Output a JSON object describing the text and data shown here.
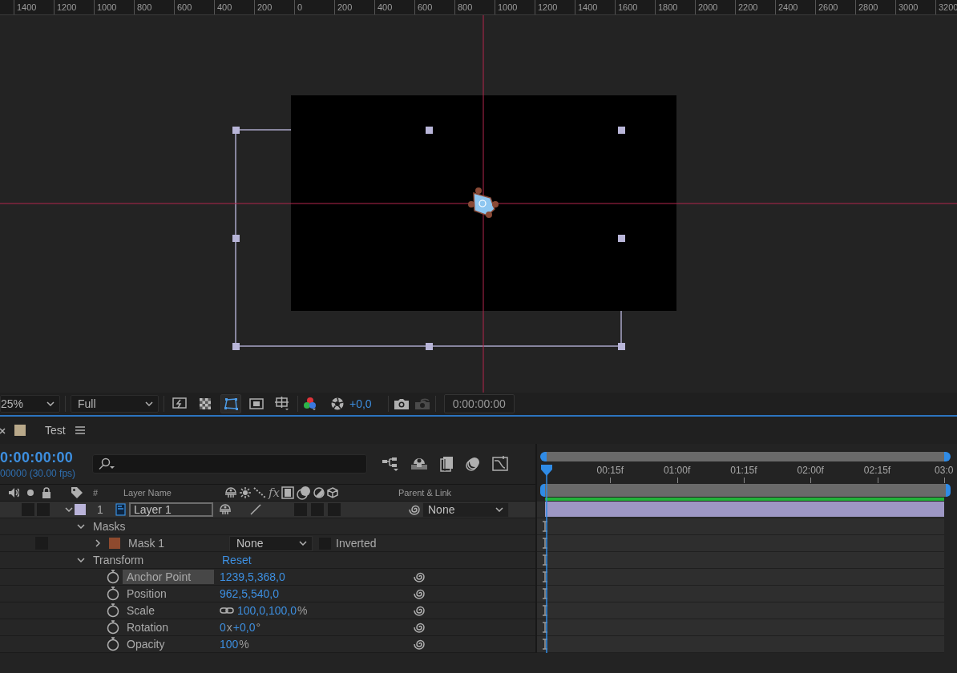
{
  "viewer": {
    "ruler_labels": [
      "1400",
      "1200",
      "1000",
      "800",
      "600",
      "400",
      "200",
      "0",
      "200",
      "400",
      "600",
      "800",
      "1000",
      "1200",
      "1400",
      "1600",
      "1800",
      "2000",
      "2200",
      "2400",
      "2600",
      "2800",
      "3000",
      "3200"
    ],
    "toolbar": {
      "zoom": "25%",
      "resolution": "Full",
      "view_buttons": [
        {
          "kind": "fast-previews",
          "selected": false
        },
        {
          "kind": "transparency-grid",
          "selected": false
        },
        {
          "kind": "mask-path",
          "selected": true
        },
        {
          "kind": "region",
          "selected": false
        },
        {
          "kind": "grid-guides",
          "selected": false
        }
      ],
      "exposure": "+0,0",
      "timecode": "0:00:00:00"
    }
  },
  "timeline": {
    "tab": {
      "title": "Test",
      "color": "#b9a98a"
    },
    "timecode": "0:00:00:00",
    "frame_info": "00000 (30.00 fps)",
    "columns": {
      "number": "#",
      "layer_name": "Layer Name",
      "fx": "fx",
      "parent": "Parent & Link"
    },
    "ruler_labels": [
      "00:15f",
      "01:00f",
      "01:15f",
      "02:00f",
      "02:15f",
      "03:0"
    ],
    "layers": [
      {
        "number": "1",
        "name": "Layer 1",
        "color": "#b9b3d9",
        "parent": "None",
        "expanded": true,
        "groups": [
          {
            "name": "Masks",
            "expanded": true,
            "masks": [
              {
                "name": "Mask 1",
                "expanded": false,
                "color": "#8e4a2e",
                "mode": "None",
                "inverted_label": "Inverted",
                "inverted": false
              }
            ]
          },
          {
            "name": "Transform",
            "expanded": true,
            "action": "Reset",
            "properties": [
              {
                "name": "Anchor Point",
                "selected": true,
                "value": [
                  {
                    "text": "1239,5,368,0",
                    "kind": "value"
                  }
                ]
              },
              {
                "name": "Position",
                "selected": false,
                "value": [
                  {
                    "text": "962,5,540,0",
                    "kind": "value"
                  }
                ]
              },
              {
                "name": "Scale",
                "selected": false,
                "linked": true,
                "value": [
                  {
                    "text": "100,0,100,0",
                    "kind": "value"
                  },
                  {
                    "text": "%",
                    "kind": "unit"
                  }
                ]
              },
              {
                "name": "Rotation",
                "selected": false,
                "value": [
                  {
                    "text": "0",
                    "kind": "value"
                  },
                  {
                    "text": "x",
                    "kind": "unit"
                  },
                  {
                    "text": "+0,0",
                    "kind": "value"
                  },
                  {
                    "text": "°",
                    "kind": "unit"
                  }
                ]
              },
              {
                "name": "Opacity",
                "selected": false,
                "value": [
                  {
                    "text": "100",
                    "kind": "value"
                  },
                  {
                    "text": "%",
                    "kind": "unit"
                  }
                ]
              }
            ]
          }
        ]
      }
    ]
  }
}
